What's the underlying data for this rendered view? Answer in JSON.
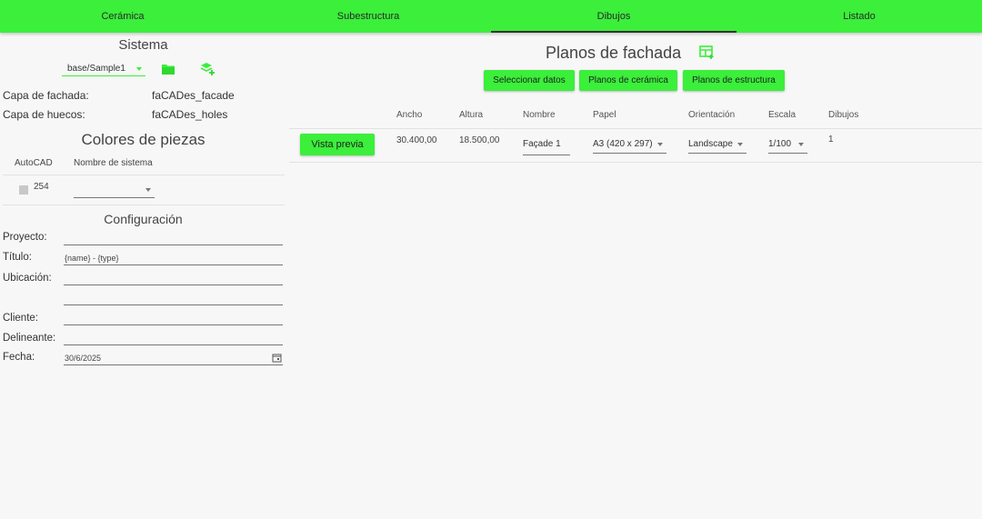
{
  "tabs": [
    {
      "label": "Cerámica"
    },
    {
      "label": "Subestructura"
    },
    {
      "label": "Dibujos"
    },
    {
      "label": "Listado"
    }
  ],
  "sistema": {
    "title": "Sistema",
    "selected": "base/Sample1",
    "folder_icon": "folder-icon",
    "add_layer_icon": "layers-add-icon"
  },
  "capas": {
    "fachada_label": "Capa de fachada:",
    "fachada_value": "faCADes_facade",
    "huecos_label": "Capa de huecos:",
    "huecos_value": "faCADes_holes"
  },
  "colores": {
    "title": "Colores de piezas",
    "col_autocad": "AutoCAD",
    "col_nombre": "Nombre de sistema",
    "rows": [
      {
        "color_code": "254",
        "swatch": "#c8c8c8",
        "nombre": ""
      }
    ]
  },
  "configuracion": {
    "title": "Configuración",
    "proyecto_label": "Proyecto:",
    "proyecto_value": "",
    "titulo_label": "Título:",
    "titulo_value": "{name} - {type}",
    "ubicacion_label": "Ubicación:",
    "ubicacion_value": "",
    "ubicacion_value2": "",
    "cliente_label": "Cliente:",
    "cliente_value": "",
    "delineante_label": "Delineante:",
    "delineante_value": "",
    "fecha_label": "Fecha:",
    "fecha_value": "30/6/2025"
  },
  "planos": {
    "title": "Planos de fachada",
    "title_icon": "table-add-icon",
    "buttons": {
      "seleccionar": "Seleccionar datos",
      "ceramica": "Planos de cerámica",
      "estructura": "Planos de estructura"
    },
    "columns": {
      "ancho": "Ancho",
      "altura": "Altura",
      "nombre": "Nombre",
      "papel": "Papel",
      "orientacion": "Orientación",
      "escala": "Escala",
      "dibujos": "Dibujos"
    },
    "rows": [
      {
        "preview_label": "Vista previa",
        "ancho": "30.400,00",
        "altura": "18.500,00",
        "nombre": "Façade 1",
        "papel": "A3 (420 x 297)",
        "orientacion": "Landscape",
        "escala": "1/100",
        "dibujos": "1"
      }
    ]
  },
  "colors": {
    "accent": "#3bef3b",
    "background": "#f7f7f7"
  }
}
